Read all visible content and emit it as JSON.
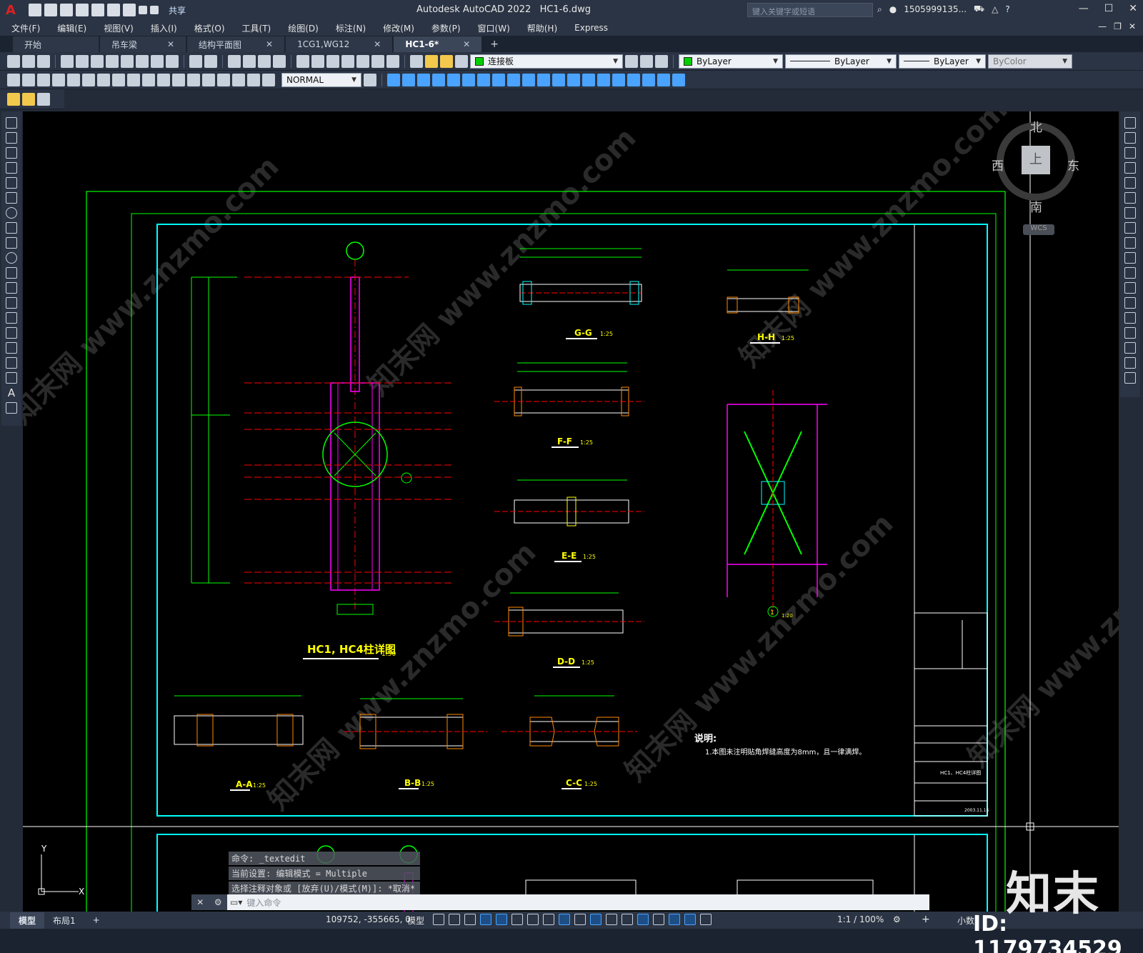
{
  "window": {
    "app_title": "Autodesk AutoCAD 2022",
    "file_name": "HC1-6.dwg",
    "share_label": "共享",
    "search_placeholder": "键入关键字或短语",
    "user": "1505999135...",
    "minimize": "—",
    "maximize": "☐",
    "close": "✕"
  },
  "menu": {
    "items": [
      "文件(F)",
      "编辑(E)",
      "视图(V)",
      "插入(I)",
      "格式(O)",
      "工具(T)",
      "绘图(D)",
      "标注(N)",
      "修改(M)",
      "参数(P)",
      "窗口(W)",
      "帮助(H)",
      "Express"
    ]
  },
  "tabs": [
    {
      "label": "开始",
      "closable": false
    },
    {
      "label": "吊车梁",
      "closable": true
    },
    {
      "label": "结构平面图",
      "closable": true
    },
    {
      "label": "1CG1,WG12",
      "closable": true
    },
    {
      "label": "HC1-6*",
      "closable": true,
      "active": true
    }
  ],
  "layer_toolbar": {
    "layer_name": "连接板",
    "color": "ByLayer",
    "linetype": "ByLayer",
    "lineweight": "ByLayer",
    "plotstyle": "ByColor"
  },
  "dim_toolbar": {
    "text_style": "NORMAL"
  },
  "viewcube": {
    "north": "北",
    "south": "南",
    "east": "东",
    "west": "西",
    "top": "上",
    "wcs": "WCS"
  },
  "drawing": {
    "main_title": "HC1, HC4柱详图",
    "main_scale": "1:50",
    "sections": [
      {
        "label": "G-G",
        "scale": "1:25"
      },
      {
        "label": "H-H",
        "scale": "1:25"
      },
      {
        "label": "F-F",
        "scale": "1:25"
      },
      {
        "label": "E-E",
        "scale": "1:25"
      },
      {
        "label": "D-D",
        "scale": "1:25"
      },
      {
        "label": "A-A",
        "scale": "1:25"
      },
      {
        "label": "B-B",
        "scale": "1:25"
      },
      {
        "label": "C-C",
        "scale": "1:25"
      }
    ],
    "detail_label": "1",
    "detail_scale": "1:20",
    "notes_title": "说明:",
    "notes_text": "1.本图未注明贴角焊缝高度为8mm，且一律满焊。",
    "titleblock_drawing_name": "HC1、HC4柱详图",
    "titleblock_date": "2003.11.15"
  },
  "command": {
    "history": [
      "命令: _textedit",
      "当前设置: 编辑模式 = Multiple",
      "选择注释对象或 [放弃(U)/模式(M)]: *取消*"
    ],
    "prompt": "键入命令"
  },
  "status": {
    "layout_tabs": [
      "模型",
      "布局1"
    ],
    "add_tab": "+",
    "coordinates": "109752, -355665, 0",
    "model_label": "模型",
    "annotation_scale": "1:1 / 100%",
    "units": "小数"
  },
  "watermark": {
    "brand": "知末",
    "id": "ID: 1179734529",
    "diagonal_text": "知末网 www.znzmo.com"
  },
  "colors": {
    "background": "#000000",
    "border_green": "#00ff00",
    "frame_cyan": "#00ffff",
    "member_magenta": "#ff00ff",
    "centerline_red": "#ff0000",
    "dim_green": "#00ff00",
    "label_yellow": "#ffff00",
    "ui_dark": "#2b3444"
  }
}
